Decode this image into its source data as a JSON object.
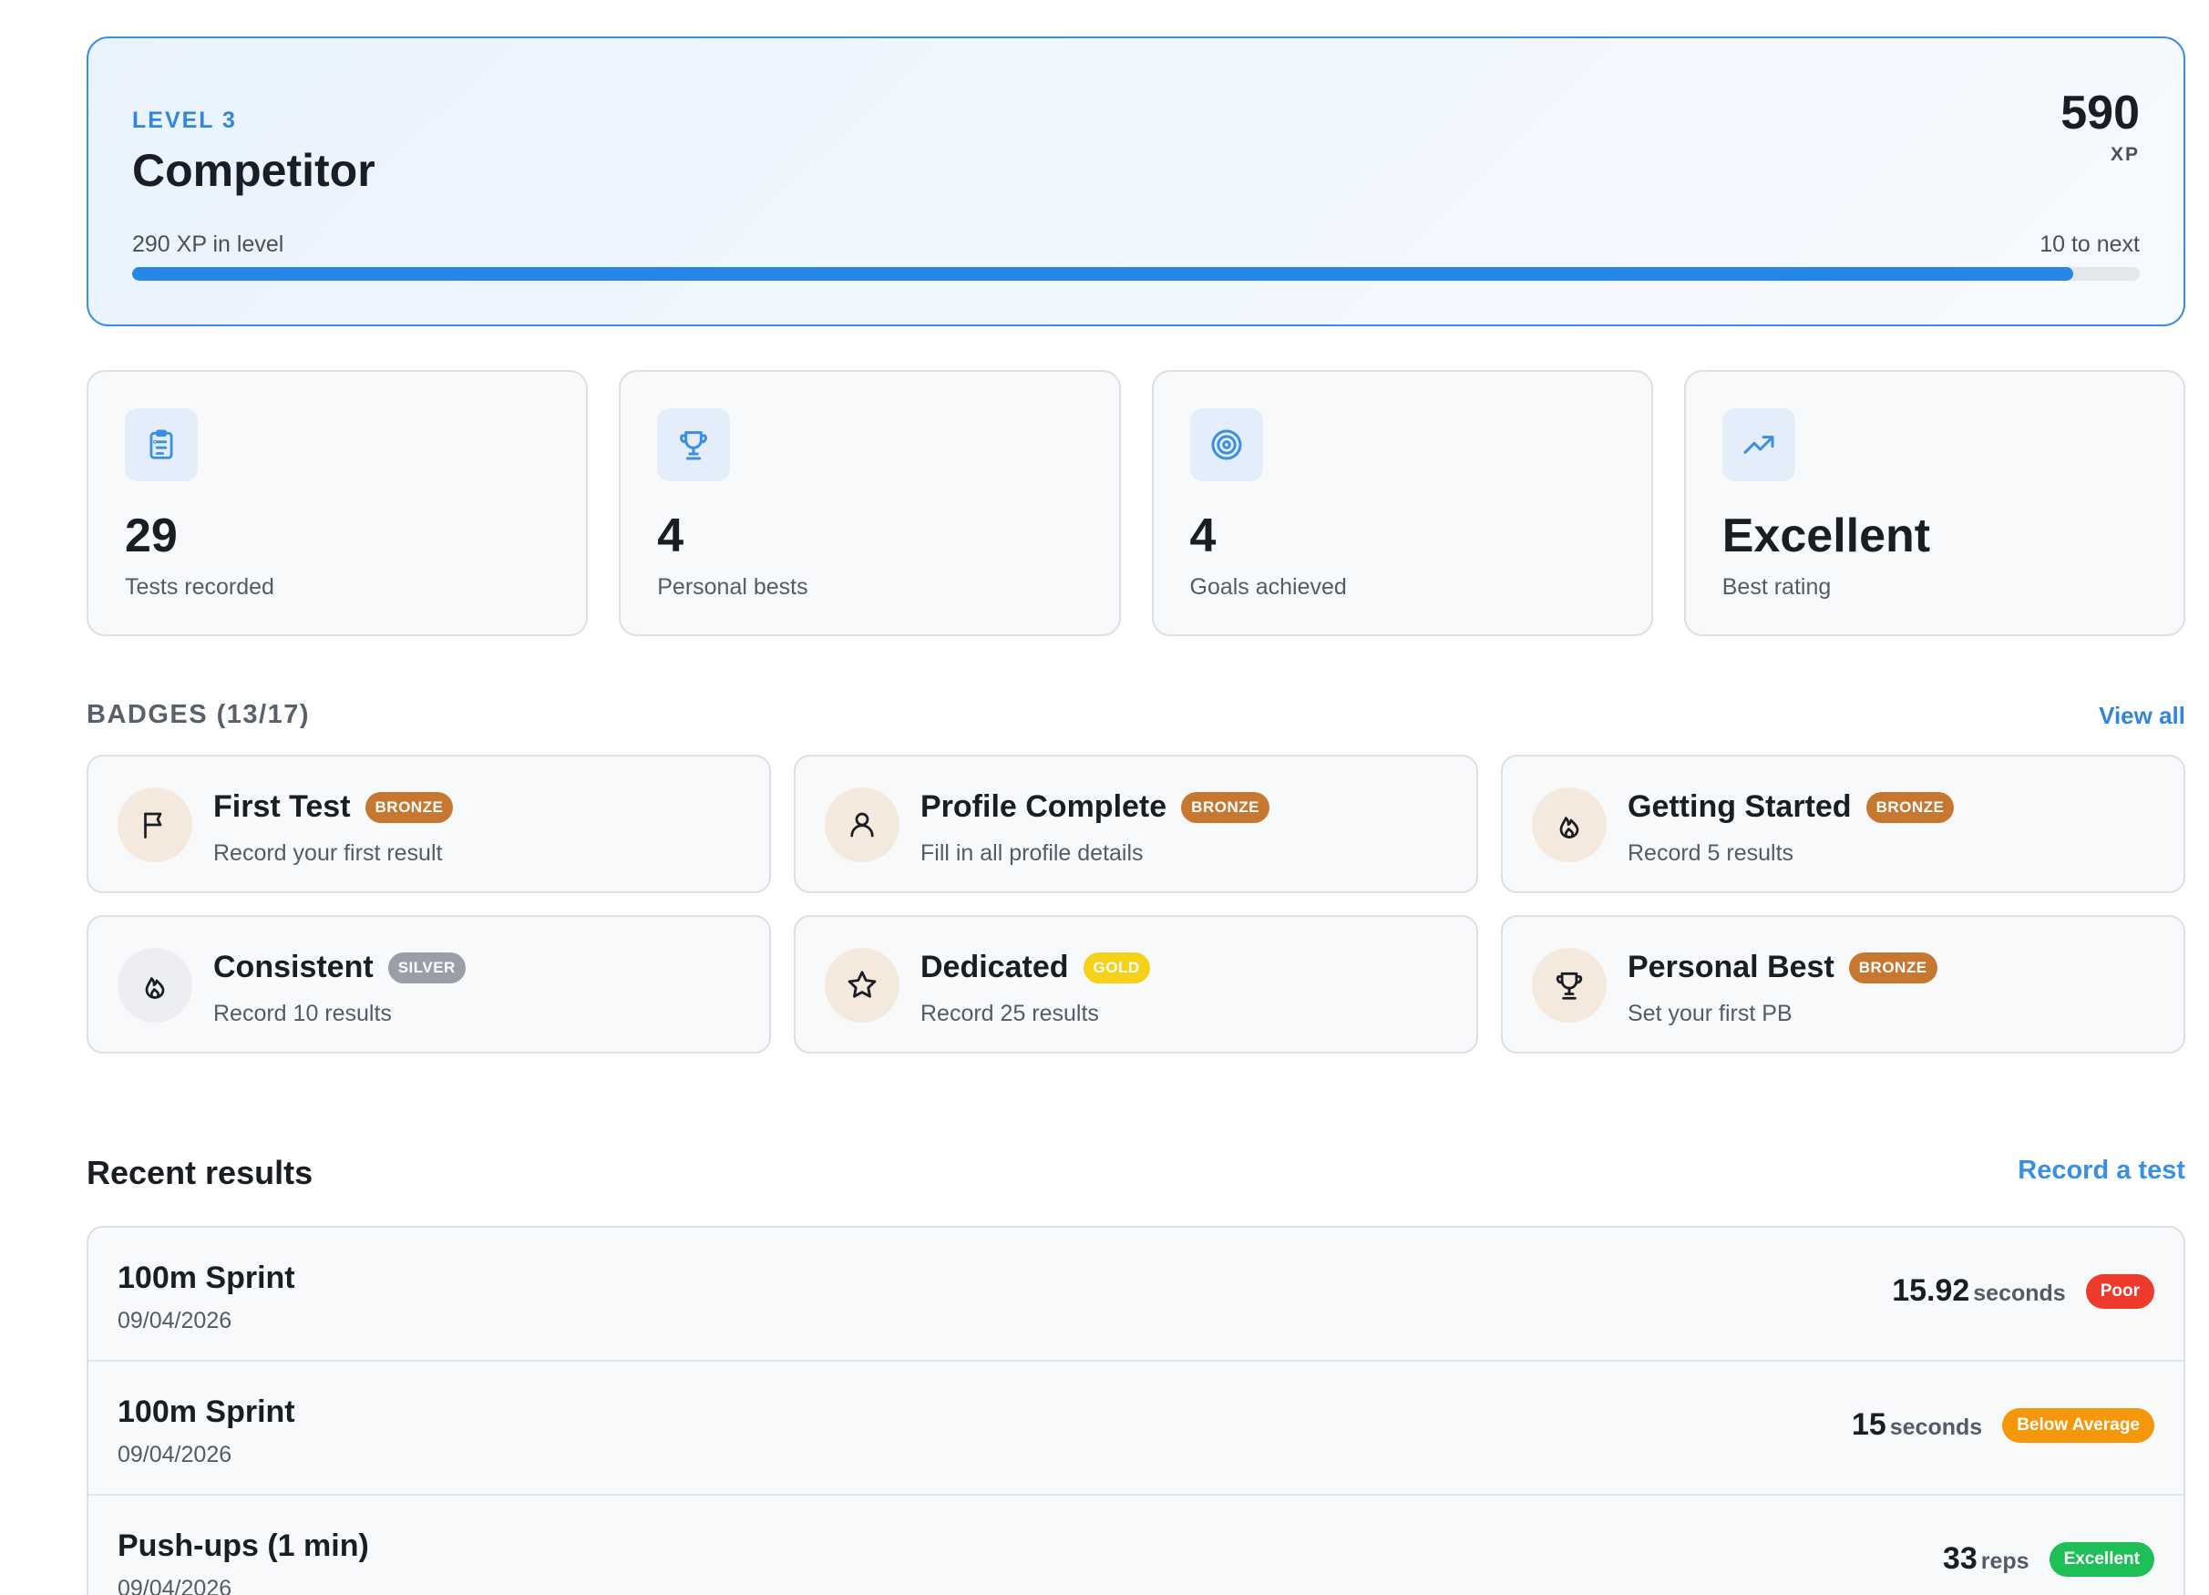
{
  "level": {
    "label": "LEVEL 3",
    "name": "Competitor",
    "xp_total": "590",
    "xp_unit": "XP",
    "in_level": "290 XP in level",
    "to_next": "10 to next",
    "progress_percent": 96.7,
    "accent_color": "#2687e6"
  },
  "stats": [
    {
      "icon": "clipboard-icon",
      "value": "29",
      "label": "Tests recorded"
    },
    {
      "icon": "trophy-icon",
      "value": "4",
      "label": "Personal bests"
    },
    {
      "icon": "target-icon",
      "value": "4",
      "label": "Goals achieved"
    },
    {
      "icon": "trending-up-icon",
      "value": "Excellent",
      "label": "Best rating"
    }
  ],
  "badges": {
    "title": "BADGES (13/17)",
    "view_all": "View all",
    "items": [
      {
        "icon": "flag-icon",
        "name": "First Test",
        "tier": "BRONZE",
        "desc": "Record your first result"
      },
      {
        "icon": "user-icon",
        "name": "Profile Complete",
        "tier": "BRONZE",
        "desc": "Fill in all profile details"
      },
      {
        "icon": "flame-icon",
        "name": "Getting Started",
        "tier": "BRONZE",
        "desc": "Record 5 results"
      },
      {
        "icon": "flame-icon",
        "name": "Consistent",
        "tier": "SILVER",
        "desc": "Record 10 results"
      },
      {
        "icon": "star-icon",
        "name": "Dedicated",
        "tier": "GOLD",
        "desc": "Record 25 results"
      },
      {
        "icon": "trophy-icon",
        "name": "Personal Best",
        "tier": "BRONZE",
        "desc": "Set your first PB"
      }
    ]
  },
  "recent": {
    "title": "Recent results",
    "record_link": "Record a test",
    "items": [
      {
        "name": "100m Sprint",
        "date": "09/04/2026",
        "value": "15.92",
        "unit": "seconds",
        "rating": "Poor",
        "rating_color": "#ef3b2d"
      },
      {
        "name": "100m Sprint",
        "date": "09/04/2026",
        "value": "15",
        "unit": "seconds",
        "rating": "Below Average",
        "rating_color": "#f5970b"
      },
      {
        "name": "Push-ups (1 min)",
        "date": "09/04/2026",
        "value": "33",
        "unit": "reps",
        "rating": "Excellent",
        "rating_color": "#1fbf58"
      }
    ]
  }
}
